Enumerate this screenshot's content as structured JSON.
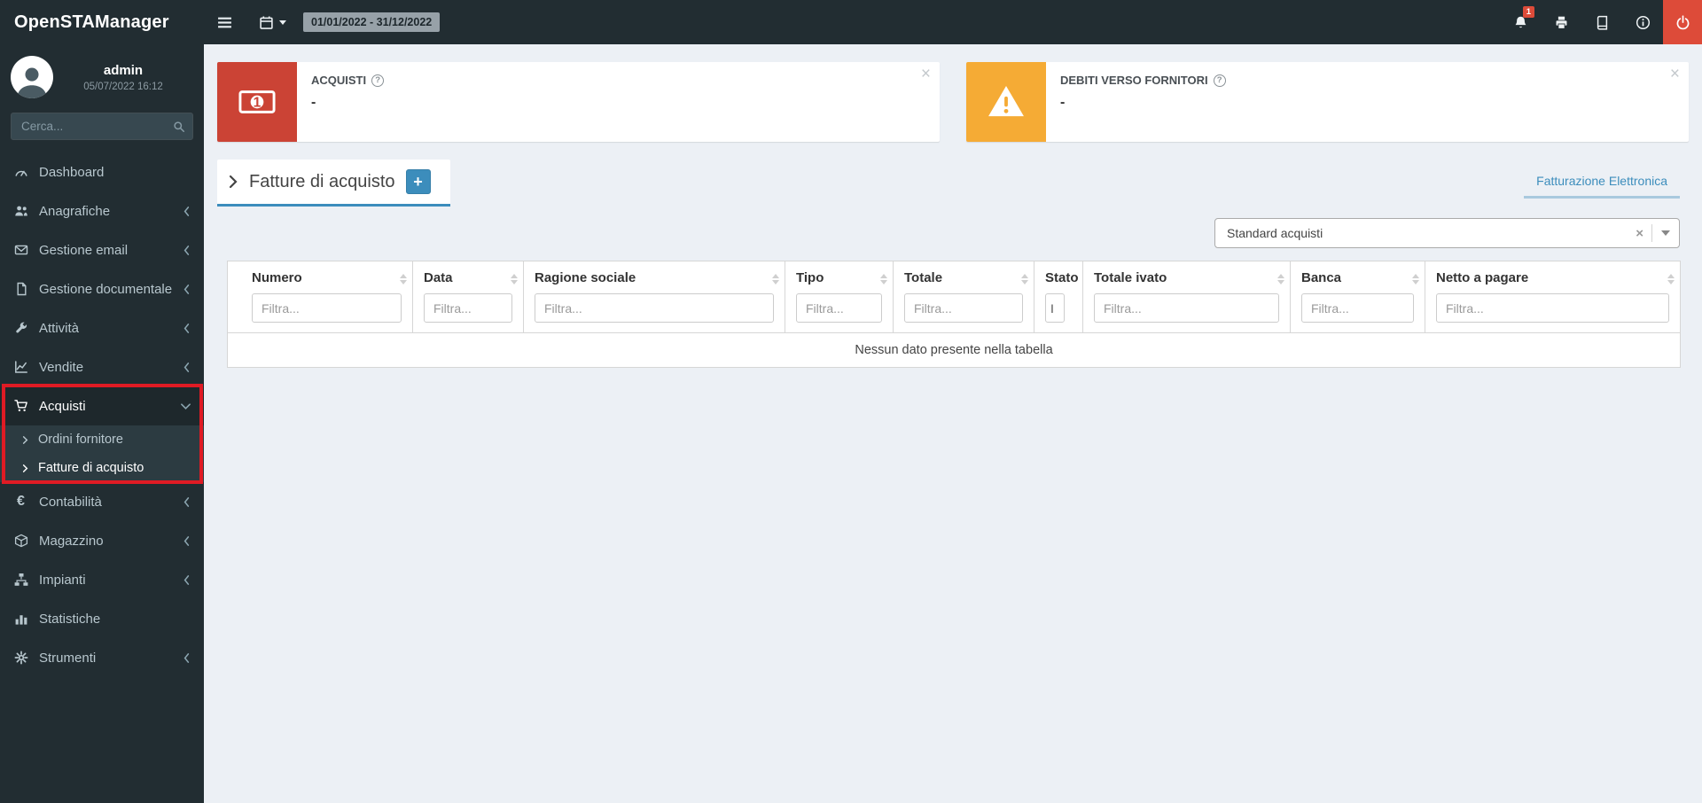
{
  "header": {
    "app_title": "OpenSTAManager",
    "date_range": "01/01/2022 - 31/12/2022",
    "notification_badge": "1"
  },
  "sidebar": {
    "user_name": "admin",
    "user_datetime": "05/07/2022 16:12",
    "search_placeholder": "Cerca...",
    "items": [
      "Dashboard",
      "Anagrafiche",
      "Gestione email",
      "Gestione documentale",
      "Attività",
      "Vendite",
      "Acquisti",
      "Contabilità",
      "Magazzino",
      "Impianti",
      "Statistiche",
      "Strumenti"
    ],
    "acquisti_submenu": [
      "Ordini fornitore",
      "Fatture di acquisto"
    ]
  },
  "infoboxes": [
    {
      "label": "ACQUISTI",
      "help": "?",
      "value": "-",
      "close": "×"
    },
    {
      "label": "DEBITI VERSO FORNITORI",
      "help": "?",
      "value": "-",
      "close": "×"
    }
  ],
  "page": {
    "title": "Fatture di acquisto",
    "add_button": "+",
    "right_tab": "Fatturazione Elettronica",
    "select_value": "Standard acquisti",
    "select_clear": "×"
  },
  "table": {
    "columns": [
      "Numero",
      "Data",
      "Ragione sociale",
      "Tipo",
      "Totale",
      "Stato",
      "Totale ivato",
      "Banca",
      "Netto a pagare"
    ],
    "filter_placeholder": "Filtra...",
    "stato_filter": "I",
    "empty_message": "Nessun dato presente nella tabella"
  },
  "icons": {
    "euro": "€",
    "one": "1"
  },
  "colors": {
    "accent": "#3c8dbc",
    "danger": "#dd4b39",
    "warning": "#f5ab35",
    "sidebar": "#222d32",
    "annotation_highlight": "#e01b24"
  }
}
